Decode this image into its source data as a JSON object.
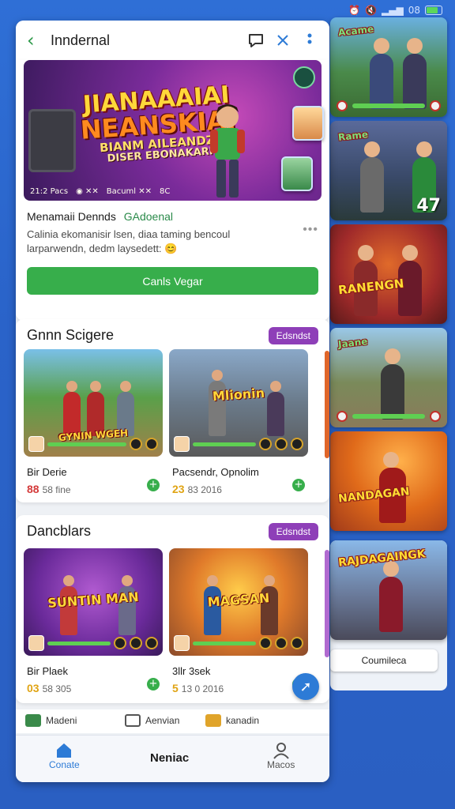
{
  "status_bar": {
    "time": "08",
    "battery_level": 0.8
  },
  "topbar": {
    "back_icon": "chevron-left",
    "title": "Inndernal",
    "actions": [
      "chat-icon",
      "close-icon",
      "more-vertical-icon"
    ]
  },
  "feature": {
    "banner_logo": {
      "line1": "JIANAAAIAI",
      "line2": "NEANSKIAI",
      "line3": "BIANM AILEANDZI",
      "line4": "DISER EBONAKARI"
    },
    "banner_strip": [
      "21:2 Pacs",
      "◉ ✕✕",
      "Bacuml ✕✕",
      "8C"
    ],
    "name": "Menamaii Dennds",
    "developer": "GAdoenal",
    "description": "Calinia ekomanisir lsen, diaa taming bencoul larparwendn, dedm laysedett:",
    "more_label": "•••",
    "cta_label": "Canls Vegar"
  },
  "sections": [
    {
      "title": "Gnnn Scigere",
      "badge": "Edsndst",
      "games": [
        {
          "name": "Bir Derie",
          "rating_prefix": "88",
          "meta": "58 fine",
          "logo": "GYNIN WGEH",
          "prefix_color": "red"
        },
        {
          "name": "Pacsendr, Opnolim",
          "rating_prefix": "23",
          "meta": "83 2016",
          "logo": "Mlionin",
          "prefix_color": "yellow"
        }
      ]
    },
    {
      "title": "Dancblars",
      "badge": "Edsndst",
      "games": [
        {
          "name": "Bir Plaek",
          "rating_prefix": "03",
          "meta": "58 305",
          "logo": "SUNTIN MAN",
          "prefix_color": "yellow"
        },
        {
          "name": "3llr 3sek",
          "rating_prefix": "5",
          "meta": "13 0 2016",
          "logo": "MAGSAN",
          "prefix_color": "yellow"
        }
      ]
    }
  ],
  "quick_links": [
    "Madeni",
    "Aenvian",
    "kanadin"
  ],
  "bottom_nav": {
    "left_label": "Conate",
    "center_label": "Neniac",
    "right_label": "Macos"
  },
  "rail": {
    "cards": [
      {
        "logo": "Acame",
        "num": ""
      },
      {
        "logo": "Rame",
        "num": "47"
      },
      {
        "logo": "RANENGN",
        "num": ""
      },
      {
        "logo": "Jaane",
        "num": ""
      },
      {
        "logo": "NANDAGAN",
        "num": ""
      },
      {
        "logo": "RAJDAGAINGK",
        "num": ""
      }
    ],
    "button_label": "Coumileca"
  },
  "colors": {
    "accent_green": "#37ae4b",
    "badge_purple": "#8e3fb8",
    "background_blue": "#2f6fd6",
    "fab_blue": "#2d7bd6"
  }
}
